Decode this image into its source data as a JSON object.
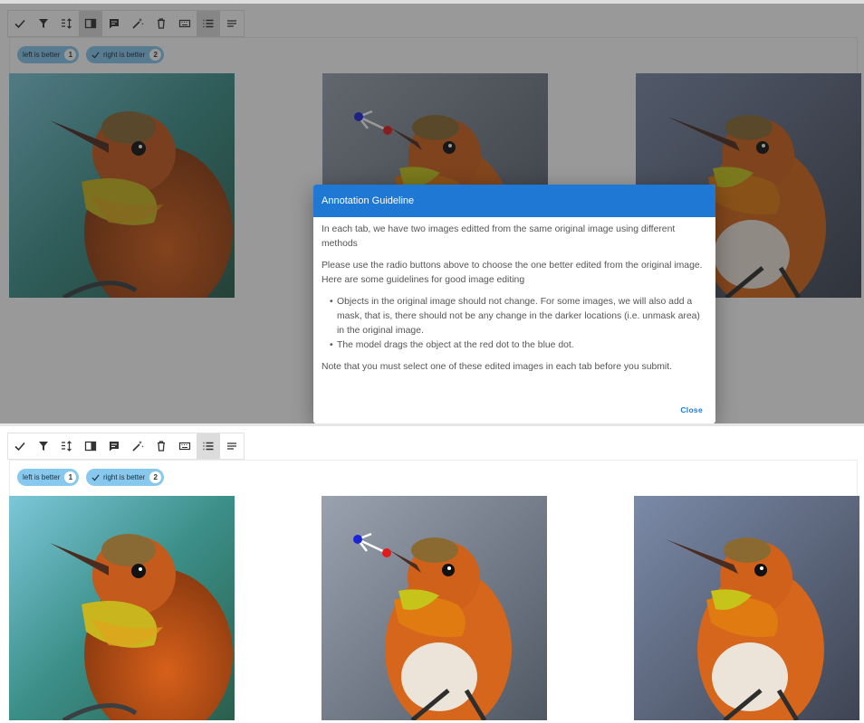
{
  "toolbar_icons": [
    "check-icon",
    "filter-icon",
    "sort-icon",
    "panel-icon",
    "comment-icon",
    "magic-wand-icon",
    "delete-icon",
    "keyboard-icon",
    "list-icon",
    "text-icon"
  ],
  "labels": {
    "left": {
      "text": "left is better",
      "key": "1"
    },
    "right": {
      "text": "right is better",
      "key": "2"
    }
  },
  "dialog": {
    "title": "Annotation Guideline",
    "para1": "In each tab, we have two images editted from the same original image using different methods",
    "para2": "Please use the radio buttons above to choose the one better edited from the original image. Here are some guidelines for good image editing",
    "bullet1": "Objects in the original image should not change. For some images, we will also add a mask, that is, there should not be any change in the darker locations (i.e. unmask area) in the original image.",
    "bullet2": "The model drags the object at the red dot to the blue dot.",
    "note": "Note that you must select one of these edited images in each tab before you submit.",
    "close_label": "Close"
  },
  "colors": {
    "accent": "#1e78d4",
    "chip": "#86c8ee",
    "overlay": "rgba(33,33,33,0.46)",
    "red_dot": "#e11a1a",
    "blue_dot": "#1a23d8"
  }
}
